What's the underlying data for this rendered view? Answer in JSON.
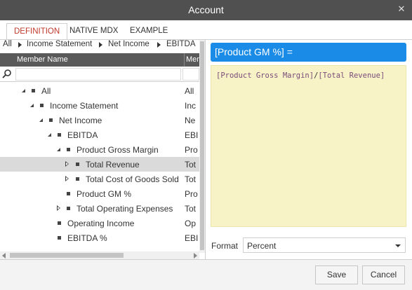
{
  "window": {
    "title": "Account",
    "close_glyph": "✕",
    "close_icon": "close-icon"
  },
  "tabs": [
    {
      "label": "DEFINITION",
      "active": true
    },
    {
      "label": "NATIVE MDX",
      "active": false
    },
    {
      "label": "EXAMPLE",
      "active": false
    }
  ],
  "breadcrumb": [
    "All",
    "Income Statement",
    "Net Income",
    "EBITDA"
  ],
  "grid": {
    "columns": [
      "Member Name",
      "Mem"
    ],
    "filter_icon": "search-icon",
    "rows": [
      {
        "label": "All",
        "col2": "All",
        "toggle": "expanded",
        "selected": false
      },
      {
        "label": "Income Statement",
        "col2": "Inc",
        "toggle": "expanded",
        "selected": false
      },
      {
        "label": "Net Income",
        "col2": "Ne",
        "toggle": "expanded",
        "selected": false
      },
      {
        "label": "EBITDA",
        "col2": "EBI",
        "toggle": "expanded",
        "selected": false
      },
      {
        "label": "Product Gross Margin",
        "col2": "Pro",
        "toggle": "expanded",
        "selected": false
      },
      {
        "label": "Total Revenue",
        "col2": "Tot",
        "toggle": "collapsed",
        "selected": true
      },
      {
        "label": "Total Cost of Goods Sold",
        "col2": "Tot",
        "toggle": "collapsed",
        "selected": false
      },
      {
        "label": "Product GM %",
        "col2": "Pro",
        "toggle": "none",
        "selected": false
      },
      {
        "label": "Total Operating Expenses",
        "col2": "Tot",
        "toggle": "collapsed",
        "selected": false
      },
      {
        "label": "Operating Income",
        "col2": "Op",
        "toggle": "none",
        "selected": false
      },
      {
        "label": "EBITDA %",
        "col2": "EBI",
        "toggle": "none",
        "selected": false
      }
    ]
  },
  "formula": {
    "header": "[Product GM %] =",
    "operand1": "[Product Gross Margin]",
    "operator": "/",
    "operand2": "[Total Revenue]"
  },
  "format": {
    "label": "Format",
    "value": "Percent"
  },
  "footer": {
    "save_label": "Save",
    "cancel_label": "Cancel"
  },
  "colors": {
    "title_bar": "#505050",
    "active_tab": "#c0392b",
    "formula_header": "#1a8be6",
    "formula_body": "#f8f2c7",
    "selected_row": "#dadada"
  }
}
